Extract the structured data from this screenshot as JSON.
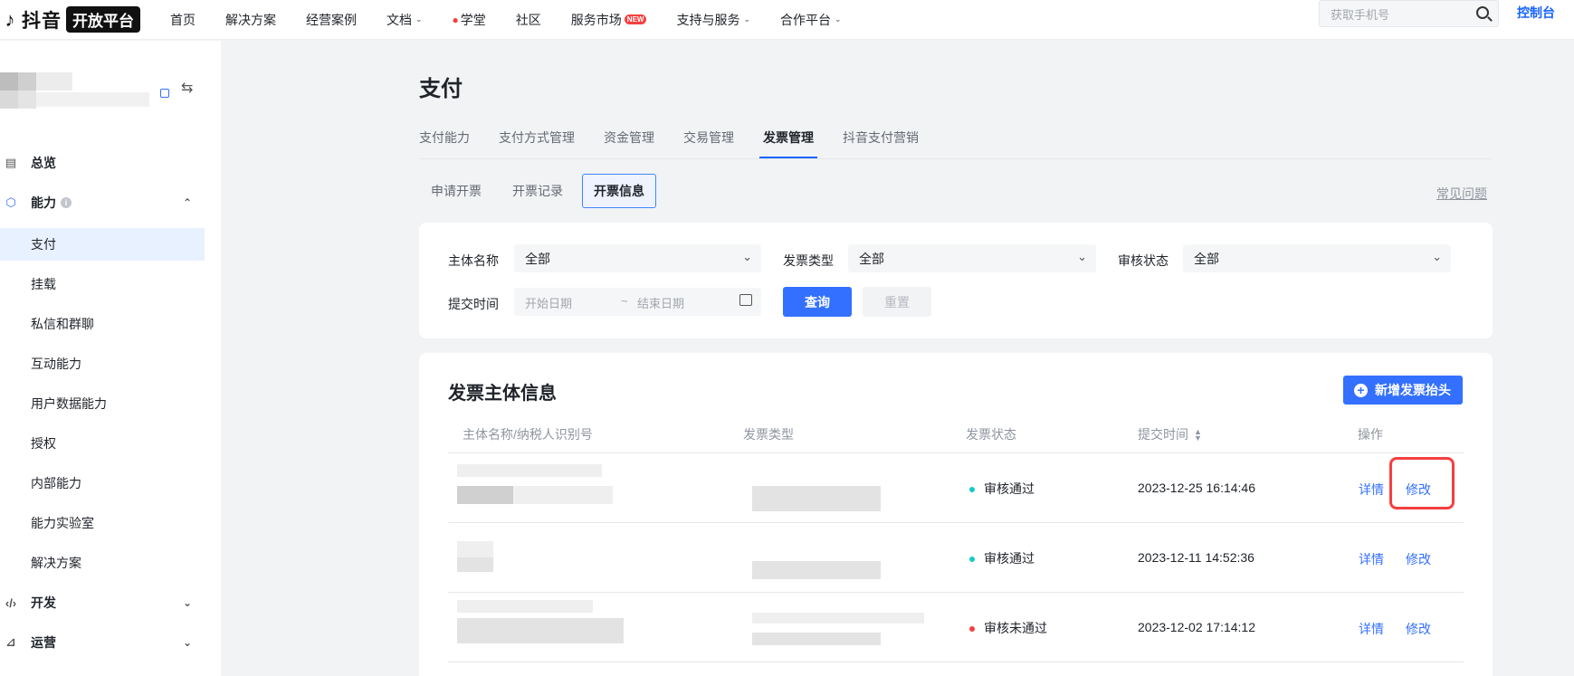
{
  "brand": {
    "logo_text": "抖音",
    "logo_badge": "开放平台"
  },
  "nav": {
    "items": [
      {
        "label": "首页"
      },
      {
        "label": "解决方案"
      },
      {
        "label": "经营案例"
      },
      {
        "label": "文档"
      },
      {
        "label": "学堂"
      },
      {
        "label": "社区"
      },
      {
        "label": "服务市场"
      },
      {
        "label": "支持与服务"
      },
      {
        "label": "合作平台"
      }
    ],
    "new_badge": "NEW",
    "search_placeholder": "获取手机号",
    "console": "控制台"
  },
  "sidebar": {
    "overview": "总览",
    "ability": "能力",
    "ability_info": "i",
    "sub_items": [
      {
        "label": "支付"
      },
      {
        "label": "挂载"
      },
      {
        "label": "私信和群聊"
      },
      {
        "label": "互动能力"
      },
      {
        "label": "用户数据能力"
      },
      {
        "label": "授权"
      },
      {
        "label": "内部能力"
      },
      {
        "label": "能力实验室"
      },
      {
        "label": "解决方案"
      }
    ],
    "develop": "开发",
    "operate": "运营"
  },
  "page": {
    "title": "支付",
    "tabs": [
      {
        "label": "支付能力"
      },
      {
        "label": "支付方式管理"
      },
      {
        "label": "资金管理"
      },
      {
        "label": "交易管理"
      },
      {
        "label": "发票管理"
      },
      {
        "label": "抖音支付营销"
      }
    ],
    "subtabs": [
      {
        "label": "申请开票"
      },
      {
        "label": "开票记录"
      },
      {
        "label": "开票信息"
      }
    ],
    "faq": "常见问题"
  },
  "filters": {
    "entity_label": "主体名称",
    "entity_value": "全部",
    "type_label": "发票类型",
    "type_value": "全部",
    "status_label": "审核状态",
    "status_value": "全部",
    "time_label": "提交时间",
    "start_placeholder": "开始日期",
    "separator": "~",
    "end_placeholder": "结束日期",
    "query": "查询",
    "reset": "重置"
  },
  "table": {
    "title": "发票主体信息",
    "add_button": "新增发票抬头",
    "columns": {
      "name": "主体名称/纳税人识别号",
      "type": "发票类型",
      "status": "发票状态",
      "time": "提交时间",
      "action": "操作"
    },
    "rows": [
      {
        "status": "审核通过",
        "status_color": "#14c9c9",
        "time": "2023-12-25 16:14:46",
        "detail": "详情",
        "edit": "修改"
      },
      {
        "status": "审核通过",
        "status_color": "#14c9c9",
        "time": "2023-12-11 14:52:36",
        "detail": "详情",
        "edit": "修改"
      },
      {
        "status": "审核未通过",
        "status_color": "#f53f3f",
        "time": "2023-12-02 17:14:12",
        "detail": "详情",
        "edit": "修改"
      }
    ]
  },
  "colors": {
    "accent": "#3370ff",
    "highlight": "#f53f3f"
  }
}
